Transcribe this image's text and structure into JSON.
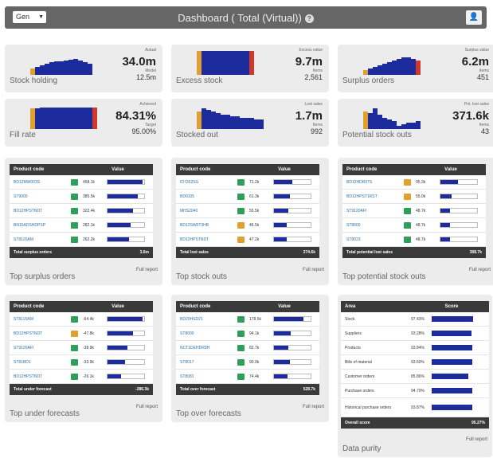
{
  "header": {
    "selector": "Gen",
    "title": "Dashboard ( Total (Virtual))",
    "info_glyph": "?",
    "user_glyph": "👤"
  },
  "kpis": [
    {
      "name": "Stock holding",
      "label1": "Actual",
      "value": "34.0m",
      "label2": "Model",
      "subvalue": "12.5m",
      "bars": [
        8,
        10,
        12,
        14,
        16,
        17,
        17,
        18,
        19,
        20,
        18,
        16,
        14
      ]
    },
    {
      "name": "Excess stock",
      "label1": "Excess value",
      "value": "9.7m",
      "label2": "Items",
      "subvalue": "2,561",
      "bars": [
        30,
        30,
        30,
        30,
        30,
        30,
        30,
        30,
        30,
        30,
        30,
        30
      ]
    },
    {
      "name": "Surplus orders",
      "label1": "Surplus value",
      "value": "6.2m",
      "label2": "Items",
      "subvalue": "451",
      "bars": [
        6,
        8,
        10,
        12,
        14,
        16,
        18,
        20,
        22,
        22,
        20,
        18
      ]
    },
    {
      "name": "Fill rate",
      "label1": "Achieved",
      "value": "84.31%",
      "label2": "Target",
      "subvalue": "95.00%",
      "bars": [
        26,
        26,
        27,
        27,
        27,
        27,
        27,
        27,
        27,
        27,
        27,
        27,
        27,
        27
      ]
    },
    {
      "name": "Stocked out",
      "label1": "Lost sales",
      "value": "1.7m",
      "label2": "Items",
      "subvalue": "992",
      "bars": [
        22,
        26,
        24,
        22,
        20,
        18,
        18,
        16,
        16,
        14,
        14,
        14,
        12,
        12
      ]
    },
    {
      "name": "Potential stock outs",
      "label1": "Pot. lost sales",
      "value": "371.6k",
      "label2": "Items",
      "subvalue": "43",
      "bars": [
        22,
        20,
        26,
        18,
        14,
        12,
        10,
        4,
        6,
        8,
        8,
        10
      ]
    }
  ],
  "colors": {
    "blue": "#1c2c9c",
    "orange": "#e0a030",
    "red": "#d0382c",
    "green": "#2f9e5a"
  },
  "tables": [
    {
      "name": "Top surplus orders",
      "col1": "Product code",
      "col2": "Value",
      "footer_label": "Total surplus orders",
      "footer_value": "3.6m",
      "full_report": "Full report",
      "rows": [
        {
          "code": "BD12MW003S",
          "icon": "green",
          "value": "458.1k",
          "pct": 0.95
        },
        {
          "code": "ST9000",
          "icon": "green",
          "value": "385.5k",
          "pct": 0.82
        },
        {
          "code": "BD12HPSTNDT",
          "icon": "green",
          "value": "322.4k",
          "pct": 0.7
        },
        {
          "code": "BN15ADSHDPSP",
          "icon": "green",
          "value": "282.1k",
          "pct": 0.62
        },
        {
          "code": "ST8120AM",
          "icon": "green",
          "value": "262.2k",
          "pct": 0.58
        }
      ]
    },
    {
      "name": "Top stock outs",
      "col1": "Product code",
      "col2": "Value",
      "footer_label": "Total lost sales",
      "footer_value": "274.6k",
      "full_report": "Full report",
      "rows": [
        {
          "code": "ID7262SG",
          "icon": "green",
          "value": "71.2k",
          "pct": 0.5
        },
        {
          "code": "BD0105",
          "icon": "green",
          "value": "61.3k",
          "pct": 0.44
        },
        {
          "code": "MHS2040",
          "icon": "green",
          "value": "55.5k",
          "pct": 0.4
        },
        {
          "code": "BD12SW0T3HB",
          "icon": "orange",
          "value": "46.5k",
          "pct": 0.34
        },
        {
          "code": "BD12HPSTNDT",
          "icon": "orange",
          "value": "47.2k",
          "pct": 0.34
        }
      ]
    },
    {
      "name": "Top potential stock outs",
      "col1": "Product code",
      "col2": "Value",
      "footer_label": "Total potential lost sales",
      "footer_value": "308.7k",
      "full_report": "Full report",
      "rows": [
        {
          "code": "BD12HDR07S",
          "icon": "orange",
          "value": "95.3k",
          "pct": 0.48
        },
        {
          "code": "BD12HPST1RST",
          "icon": "orange",
          "value": "55.0k",
          "pct": 0.3
        },
        {
          "code": "ST9120AFI",
          "icon": "green",
          "value": "48.7k",
          "pct": 0.27
        },
        {
          "code": "ST8000",
          "icon": "green",
          "value": "48.7k",
          "pct": 0.27
        },
        {
          "code": "ST8023",
          "icon": "green",
          "value": "48.7k",
          "pct": 0.27
        }
      ]
    },
    {
      "name": "Top under forecasts",
      "col1": "Product code",
      "col2": "Value",
      "footer_label": "Total under forecast",
      "footer_value": "-286.3k",
      "full_report": "Full report",
      "rows": [
        {
          "code": "ST8120AM",
          "icon": "green",
          "value": "-64.4k",
          "pct": 0.95
        },
        {
          "code": "BD12HPSTNDT",
          "icon": "orange",
          "value": "-47.8k",
          "pct": 0.7
        },
        {
          "code": "ST9120AFI",
          "icon": "green",
          "value": "-38.9k",
          "pct": 0.55
        },
        {
          "code": "ST81BD1",
          "icon": "green",
          "value": "-33.9k",
          "pct": 0.48
        },
        {
          "code": "BD12HPSTNDT",
          "icon": "green",
          "value": "-26.1k",
          "pct": 0.38
        }
      ]
    },
    {
      "name": "Top over forecasts",
      "col1": "Product code",
      "col2": "Value",
      "footer_label": "Total over forecast",
      "footer_value": "528.7k",
      "full_report": "Full report",
      "rows": [
        {
          "code": "BD20HSD21",
          "icon": "green",
          "value": "178.5k",
          "pct": 0.8
        },
        {
          "code": "ST8000",
          "icon": "green",
          "value": "94.1k",
          "pct": 0.45
        },
        {
          "code": "NCT1DEHDR9H",
          "icon": "green",
          "value": "82.7k",
          "pct": 0.4
        },
        {
          "code": "ST8017",
          "icon": "green",
          "value": "90.0k",
          "pct": 0.44
        },
        {
          "code": "ST8081",
          "icon": "green",
          "value": "74.4k",
          "pct": 0.36
        }
      ]
    }
  ],
  "data_purity": {
    "name": "Data purity",
    "col1": "Area",
    "col2": "Score",
    "footer_label": "Overall score",
    "footer_value": "95.27%",
    "full_report": "Full report",
    "rows": [
      {
        "area": "Stock",
        "score": "97.43%",
        "pct": 0.97
      },
      {
        "area": "Suppliers",
        "score": "93.28%",
        "pct": 0.93
      },
      {
        "area": "Products",
        "score": "93.84%",
        "pct": 0.94
      },
      {
        "area": "Bills of material",
        "score": "93.60%",
        "pct": 0.94
      },
      {
        "area": "Customer orders",
        "score": "85.86%",
        "pct": 0.86
      },
      {
        "area": "Purchase orders",
        "score": "94.70%",
        "pct": 0.95
      },
      {
        "area": "Historical purchase orders",
        "score": "93.87%",
        "pct": 0.94
      }
    ]
  }
}
